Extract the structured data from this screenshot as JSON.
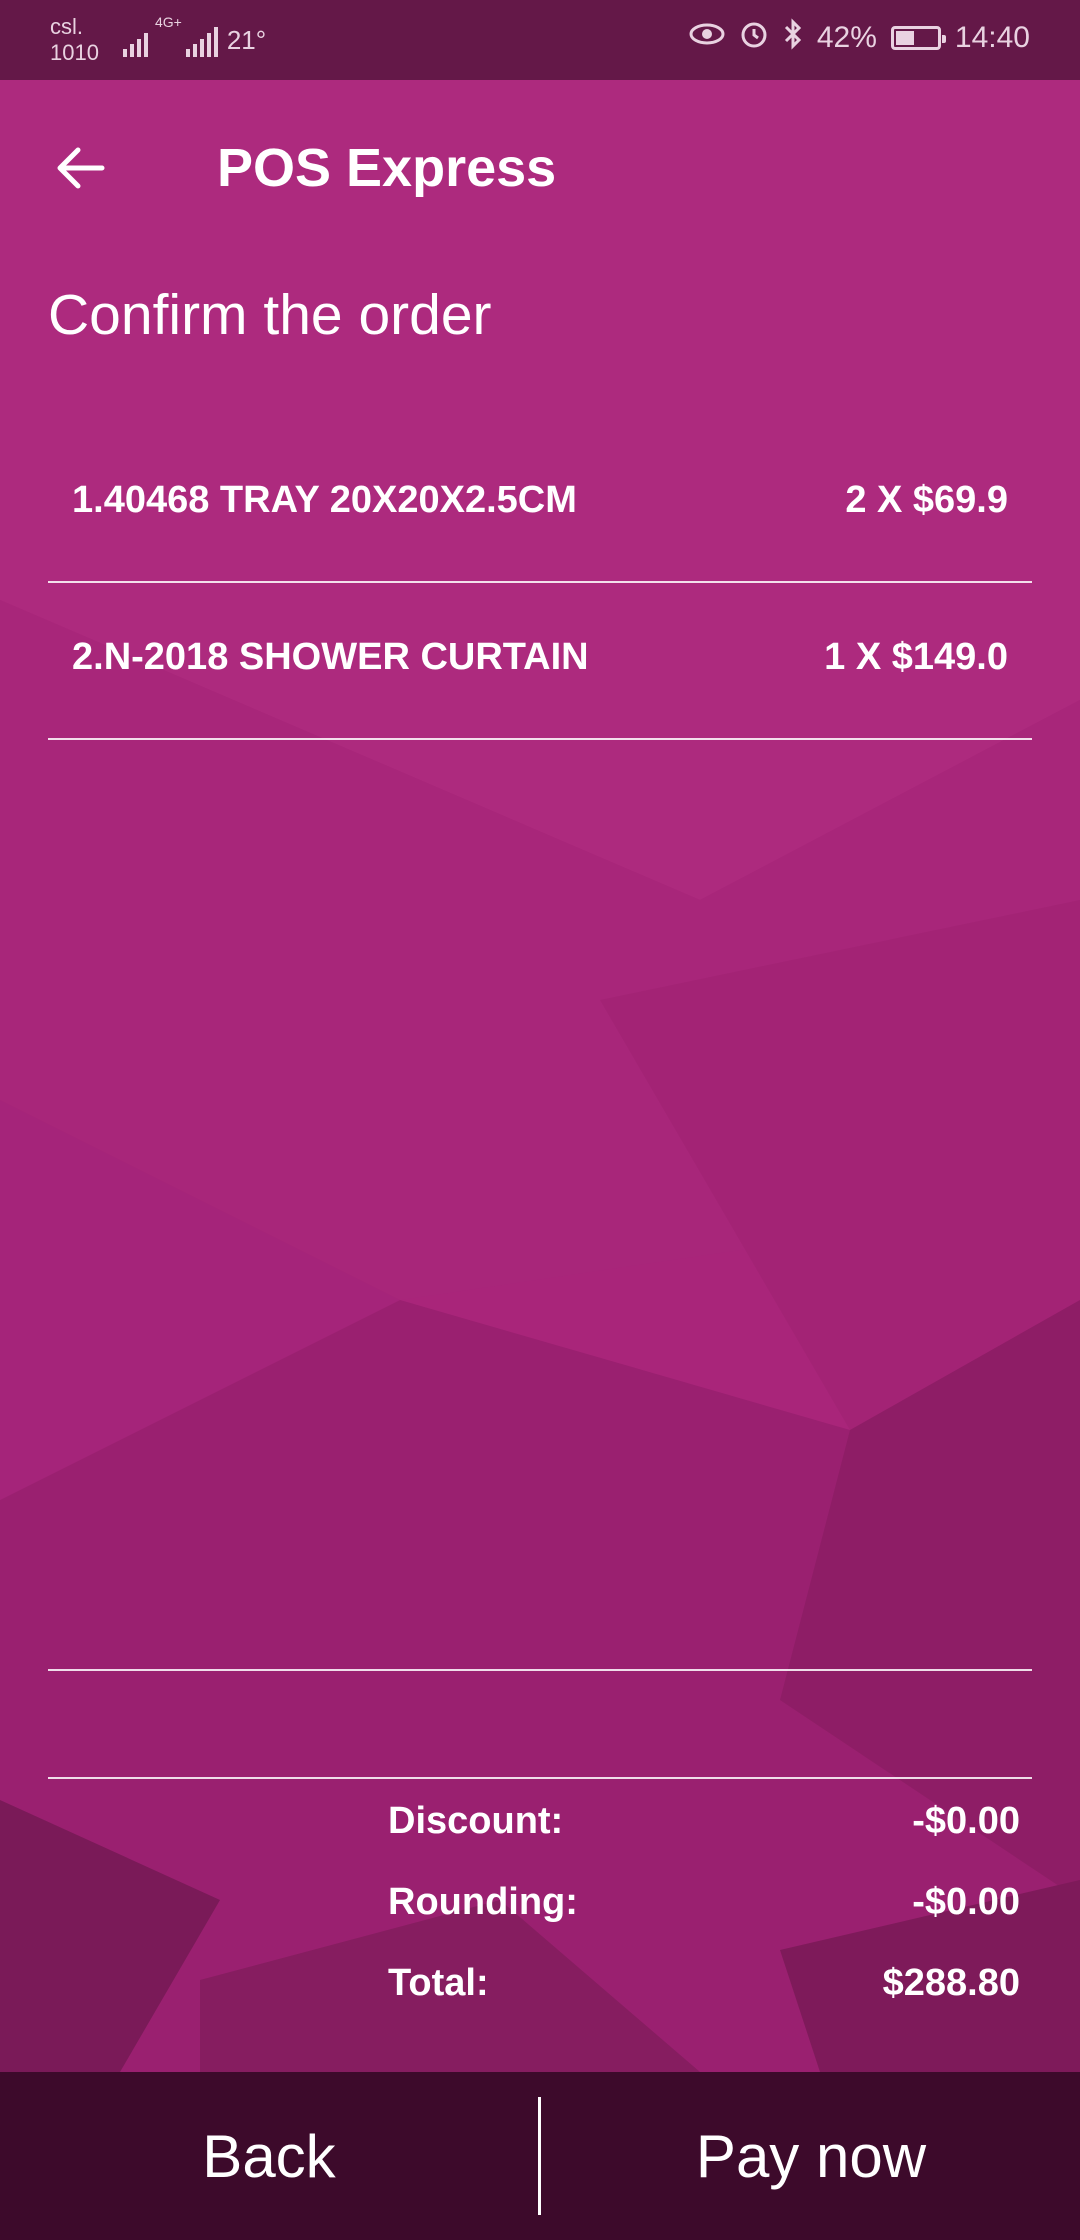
{
  "status_bar": {
    "carrier_line1": "csl.",
    "carrier_line2": "1010",
    "network": "4G+",
    "temperature": "21°",
    "battery": "42%",
    "time": "14:40",
    "icons": [
      "signal-icon",
      "eye-icon",
      "alarm-icon",
      "bluetooth-icon",
      "battery-icon"
    ]
  },
  "app_bar": {
    "back_icon": "arrow-left-icon",
    "title": "POS Express"
  },
  "page": {
    "title": "Confirm the order"
  },
  "order_items": [
    {
      "name": "1.40468 TRAY 20X20X2.5CM",
      "quantity_price": "2 X $69.9"
    },
    {
      "name": "2.N-2018 SHOWER CURTAIN",
      "quantity_price": "1 X $149.0"
    }
  ],
  "summary": {
    "discount_label": "Discount:",
    "discount_value": "-$0.00",
    "rounding_label": "Rounding:",
    "rounding_value": "-$0.00",
    "total_label": "Total:",
    "total_value": "$288.80"
  },
  "bottom_bar": {
    "back_label": "Back",
    "pay_label": "Pay now"
  },
  "colors": {
    "background": "#a9257a",
    "status_bar": "#641848",
    "bottom_bar": "#3a0a28",
    "text": "#ffffff"
  }
}
